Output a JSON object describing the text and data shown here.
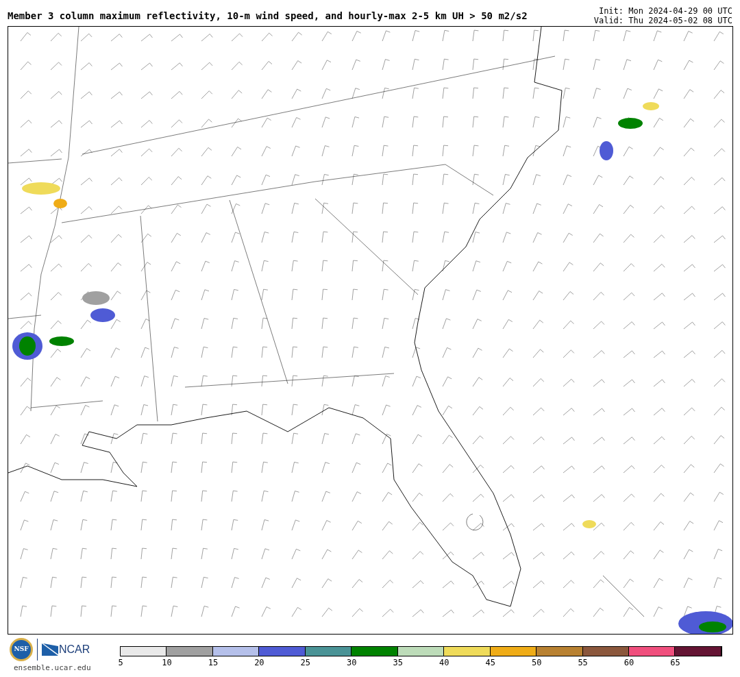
{
  "title": "Member 3 column maximum reflectivity, 10-m wind speed, and hourly-max 2-5 km UH > 50 m2/s2",
  "init": "Init: Mon 2024-04-29 00 UTC",
  "valid": "Valid: Thu 2024-05-02 08 UTC",
  "logos": {
    "nsf": "NSF",
    "ncar": "NCAR",
    "url": "ensemble.ucar.edu"
  },
  "colorbar": {
    "segments": [
      {
        "color": "#e9e9e9"
      },
      {
        "color": "#a0a0a0"
      },
      {
        "color": "#b5c0ea"
      },
      {
        "color": "#4f5bd5"
      },
      {
        "color": "#4a9396"
      },
      {
        "color": "#008200"
      },
      {
        "color": "#bddcb9"
      },
      {
        "color": "#efdb5a"
      },
      {
        "color": "#efac17"
      },
      {
        "color": "#b88131"
      },
      {
        "color": "#8b573c"
      },
      {
        "color": "#f04f7d"
      },
      {
        "color": "#641433"
      }
    ],
    "ticks": [
      "5",
      "10",
      "15",
      "20",
      "25",
      "30",
      "35",
      "40",
      "45",
      "50",
      "55",
      "60",
      "65"
    ]
  }
}
